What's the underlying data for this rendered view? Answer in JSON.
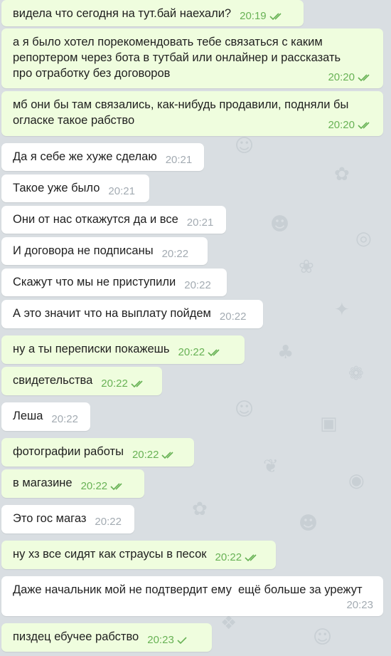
{
  "theme": {
    "outgoing_bg": "#effdde",
    "incoming_bg": "#ffffff",
    "outgoing_time": "#68b255",
    "incoming_time": "#a3abb2",
    "wallpaper": "#d9dee2"
  },
  "messages": [
    {
      "dir": "out",
      "text": "видела что сегодня на тут.бай наехали?",
      "time": "20:19",
      "status": "read"
    },
    {
      "dir": "out",
      "text": "а я было хотел порекомендовать тебе связаться с каким\nрепортером через бота в тутбай или онлайнер и рассказать\nпро отработку без договоров",
      "time": "20:20",
      "status": "read"
    },
    {
      "dir": "out",
      "text": "мб они бы там связались, как-нибудь продавили, подняли бы\nогласке такое рабство",
      "time": "20:20",
      "status": "read"
    },
    {
      "dir": "in",
      "text": "Да я себе же хуже сделаю",
      "time": "20:21"
    },
    {
      "dir": "in",
      "text": "Такое уже было",
      "time": "20:21"
    },
    {
      "dir": "in",
      "text": "Они от нас откажутся да и все",
      "time": "20:21"
    },
    {
      "dir": "in",
      "text": "И договора не подписаны",
      "time": "20:22"
    },
    {
      "dir": "in",
      "text": "Скажут что мы не приступили",
      "time": "20:22"
    },
    {
      "dir": "in",
      "text": "А это значит что на выплату пойдем",
      "time": "20:22"
    },
    {
      "dir": "out",
      "text": "ну а ты переписки покажешь",
      "time": "20:22",
      "status": "read"
    },
    {
      "dir": "out",
      "text": "свидетельства",
      "time": "20:22",
      "status": "read"
    },
    {
      "dir": "in",
      "text": "Леша",
      "time": "20:22"
    },
    {
      "dir": "out",
      "text": "фотографии работы",
      "time": "20:22",
      "status": "read"
    },
    {
      "dir": "out",
      "text": "в магазине",
      "time": "20:22",
      "status": "read"
    },
    {
      "dir": "in",
      "text": "Это гос магаз",
      "time": "20:22"
    },
    {
      "dir": "out",
      "text": "ну хз все сидят как страусы в песок",
      "time": "20:22",
      "status": "read"
    },
    {
      "dir": "in",
      "text": "Даже начальник мой не подтвердит ему  ещё больше за урежут",
      "time": "20:23"
    },
    {
      "dir": "out",
      "text": "пиздец ебучее рабство",
      "time": "20:23",
      "status": "sent"
    }
  ]
}
